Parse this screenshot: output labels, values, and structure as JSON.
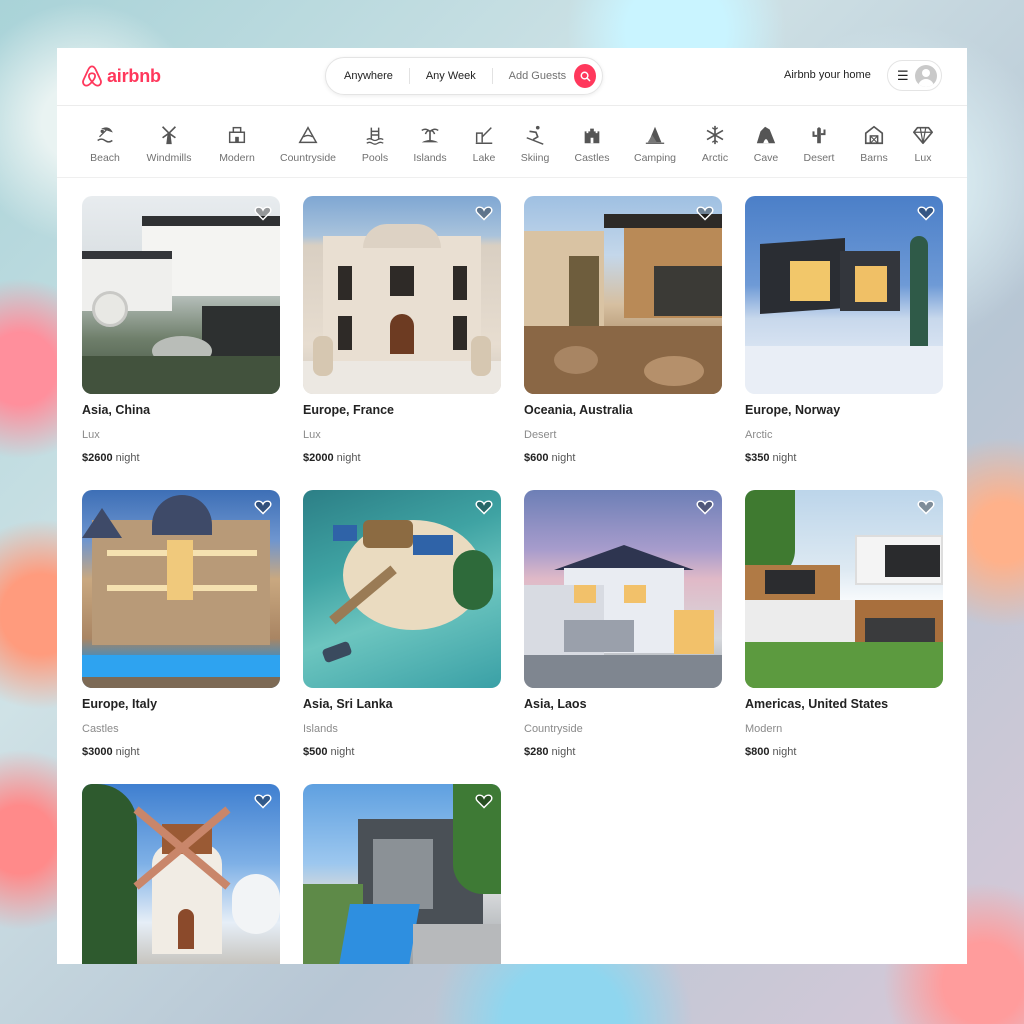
{
  "brand": {
    "name": "airbnb",
    "color": "#ff385c"
  },
  "search": {
    "location": "Anywhere",
    "week": "Any Week",
    "guests_placeholder": "Add Guests",
    "icon": "search-icon"
  },
  "header": {
    "host_link": "Airbnb your home",
    "menu_icon": "hamburger-icon",
    "avatar_icon": "user-avatar-icon"
  },
  "categories": [
    {
      "label": "Beach",
      "icon": "beach-icon"
    },
    {
      "label": "Windmills",
      "icon": "windmill-icon"
    },
    {
      "label": "Modern",
      "icon": "modern-house-icon"
    },
    {
      "label": "Countryside",
      "icon": "countryside-icon"
    },
    {
      "label": "Pools",
      "icon": "pool-icon"
    },
    {
      "label": "Islands",
      "icon": "island-icon"
    },
    {
      "label": "Lake",
      "icon": "lake-icon"
    },
    {
      "label": "Skiing",
      "icon": "skiing-icon"
    },
    {
      "label": "Castles",
      "icon": "castle-icon"
    },
    {
      "label": "Camping",
      "icon": "camping-icon"
    },
    {
      "label": "Arctic",
      "icon": "snowflake-icon"
    },
    {
      "label": "Cave",
      "icon": "cave-icon"
    },
    {
      "label": "Desert",
      "icon": "cactus-icon"
    },
    {
      "label": "Barns",
      "icon": "barn-icon"
    },
    {
      "label": "Lux",
      "icon": "diamond-icon"
    }
  ],
  "listings": [
    {
      "location": "Asia, China",
      "category": "Lux",
      "price": "$2600",
      "unit": "night"
    },
    {
      "location": "Europe, France",
      "category": "Lux",
      "price": "$2000",
      "unit": "night"
    },
    {
      "location": "Oceania, Australia",
      "category": "Desert",
      "price": "$600",
      "unit": "night"
    },
    {
      "location": "Europe, Norway",
      "category": "Arctic",
      "price": "$350",
      "unit": "night"
    },
    {
      "location": "Europe, Italy",
      "category": "Castles",
      "price": "$3000",
      "unit": "night"
    },
    {
      "location": "Asia, Sri Lanka",
      "category": "Islands",
      "price": "$500",
      "unit": "night"
    },
    {
      "location": "Asia, Laos",
      "category": "Countryside",
      "price": "$280",
      "unit": "night"
    },
    {
      "location": "Americas, United States",
      "category": "Modern",
      "price": "$800",
      "unit": "night"
    },
    {
      "location": "",
      "category": "",
      "price": "",
      "unit": ""
    },
    {
      "location": "",
      "category": "",
      "price": "",
      "unit": ""
    }
  ]
}
